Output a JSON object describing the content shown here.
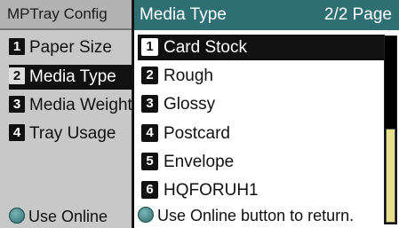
{
  "background_menu": {
    "title": "MPTray Config",
    "items": [
      {
        "num": "1",
        "label": "Paper Size"
      },
      {
        "num": "2",
        "label": "Media Type"
      },
      {
        "num": "3",
        "label": "Media Weight"
      },
      {
        "num": "4",
        "label": "Tray Usage"
      }
    ],
    "footer": "Use Online"
  },
  "popup": {
    "title": "Media Type",
    "page_indicator": "2/2 Page",
    "items": [
      {
        "num": "1",
        "label": "Card Stock"
      },
      {
        "num": "2",
        "label": "Rough"
      },
      {
        "num": "3",
        "label": "Glossy"
      },
      {
        "num": "4",
        "label": "Postcard"
      },
      {
        "num": "5",
        "label": "Envelope"
      },
      {
        "num": "6",
        "label": "HQFORUH1"
      }
    ],
    "footer": "Use Online button to return.",
    "scroll_position": 0.5
  },
  "colors": {
    "header_teal": "#2e6f73",
    "scroll_thumb": "#e6e08a",
    "background_panel": "#c8c8c8"
  },
  "icons": {
    "online_button": "online-button-icon"
  }
}
